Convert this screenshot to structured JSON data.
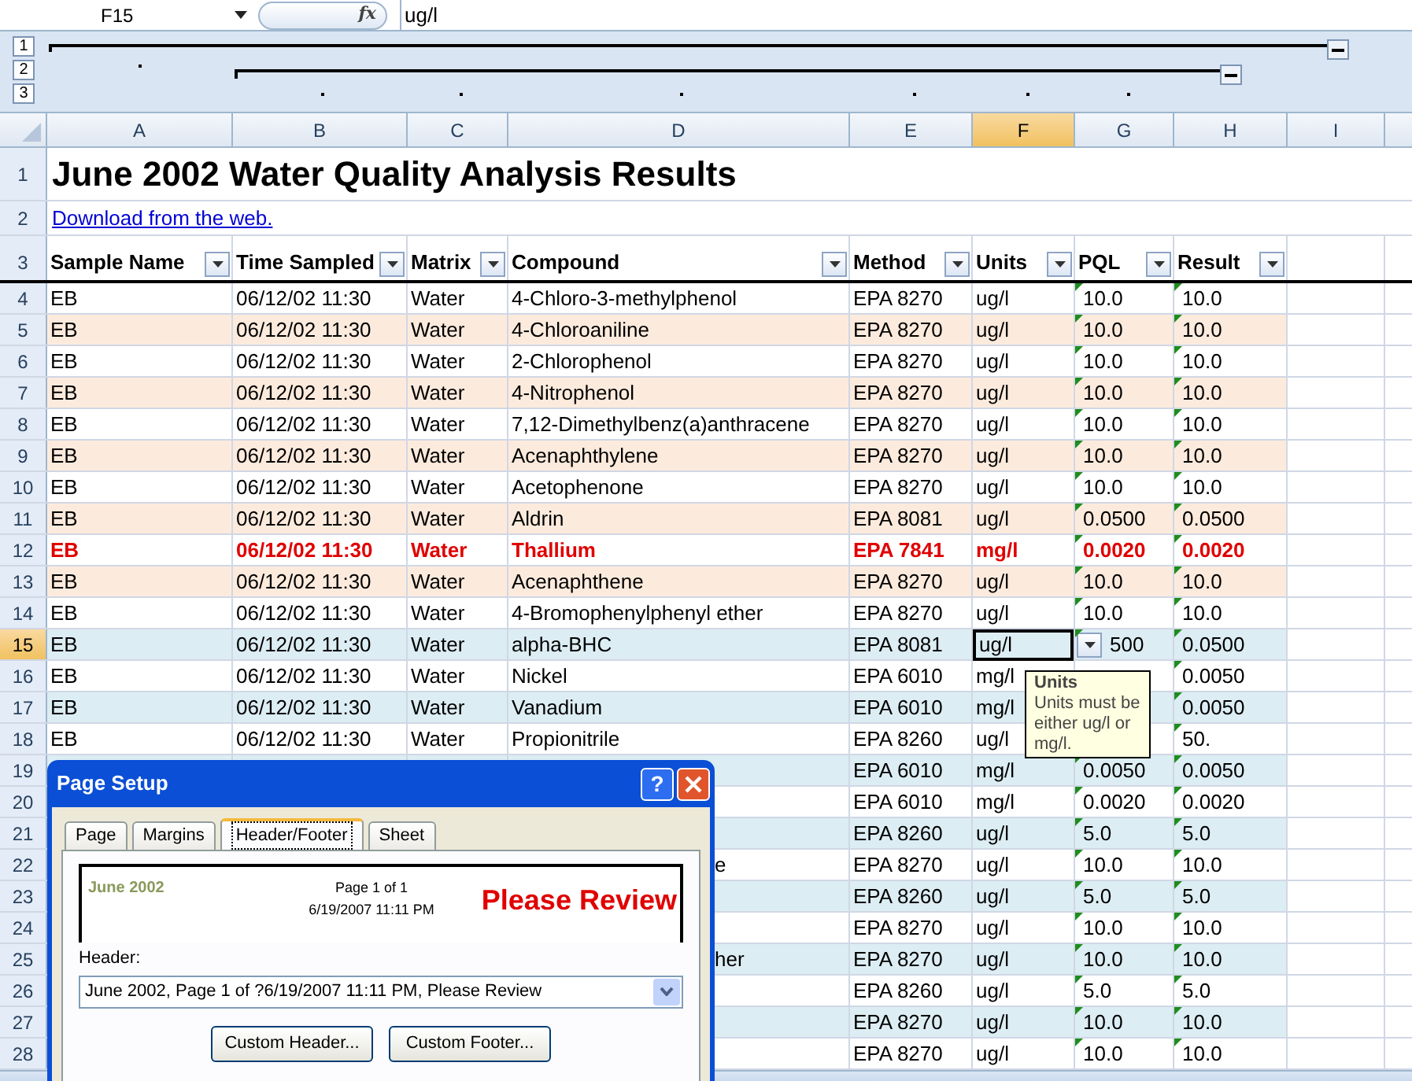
{
  "formula_bar": {
    "name_box": "F15",
    "function_label": "fx",
    "value": "ug/l"
  },
  "outline_levels": [
    "1",
    "2",
    "3"
  ],
  "columns": [
    {
      "label": "A",
      "selected": false
    },
    {
      "label": "B",
      "selected": false
    },
    {
      "label": "C",
      "selected": false
    },
    {
      "label": "D",
      "selected": false
    },
    {
      "label": "E",
      "selected": false
    },
    {
      "label": "F",
      "selected": true
    },
    {
      "label": "G",
      "selected": false
    },
    {
      "label": "H",
      "selected": false
    },
    {
      "label": "I",
      "selected": false
    }
  ],
  "title_row": {
    "n": "1",
    "title": "June 2002 Water Quality Analysis Results"
  },
  "link_row": {
    "n": "2",
    "link": "Download from the web."
  },
  "header_row": {
    "n": "3",
    "headers": [
      {
        "label": "Sample Name",
        "filter": true
      },
      {
        "label": "Time Sampled",
        "filter": true
      },
      {
        "label": "Matrix",
        "filter": true
      },
      {
        "label": "Compound",
        "filter": true
      },
      {
        "label": "Method",
        "filter": true
      },
      {
        "label": "Units",
        "filter": true
      },
      {
        "label": "PQL",
        "filter": true
      },
      {
        "label": "Result",
        "filter": true
      }
    ]
  },
  "rows": [
    {
      "n": "4",
      "color": "#ffffff",
      "flagged": false,
      "selected": false,
      "covered": false,
      "sample": "EB",
      "time": "06/12/02 11:30",
      "matrix": "Water",
      "compound": "4-Chloro-3-methylphenol",
      "method": "EPA 8270",
      "units": "ug/l",
      "pql": "10.0",
      "result": "10.0"
    },
    {
      "n": "5",
      "color": "#fcebdd",
      "flagged": false,
      "selected": false,
      "covered": false,
      "sample": "EB",
      "time": "06/12/02 11:30",
      "matrix": "Water",
      "compound": "4-Chloroaniline",
      "method": "EPA 8270",
      "units": "ug/l",
      "pql": "10.0",
      "result": "10.0"
    },
    {
      "n": "6",
      "color": "#ffffff",
      "flagged": false,
      "selected": false,
      "covered": false,
      "sample": "EB",
      "time": "06/12/02 11:30",
      "matrix": "Water",
      "compound": "2-Chlorophenol",
      "method": "EPA 8270",
      "units": "ug/l",
      "pql": "10.0",
      "result": "10.0"
    },
    {
      "n": "7",
      "color": "#fcebdd",
      "flagged": false,
      "selected": false,
      "covered": false,
      "sample": "EB",
      "time": "06/12/02 11:30",
      "matrix": "Water",
      "compound": "4-Nitrophenol",
      "method": "EPA 8270",
      "units": "ug/l",
      "pql": "10.0",
      "result": "10.0"
    },
    {
      "n": "8",
      "color": "#ffffff",
      "flagged": false,
      "selected": false,
      "covered": false,
      "sample": "EB",
      "time": "06/12/02 11:30",
      "matrix": "Water",
      "compound": "7,12-Dimethylbenz(a)anthracene",
      "method": "EPA 8270",
      "units": "ug/l",
      "pql": "10.0",
      "result": "10.0"
    },
    {
      "n": "9",
      "color": "#fcebdd",
      "flagged": false,
      "selected": false,
      "covered": false,
      "sample": "EB",
      "time": "06/12/02 11:30",
      "matrix": "Water",
      "compound": "Acenaphthylene",
      "method": "EPA 8270",
      "units": "ug/l",
      "pql": "10.0",
      "result": "10.0"
    },
    {
      "n": "10",
      "color": "#ffffff",
      "flagged": false,
      "selected": false,
      "covered": false,
      "sample": "EB",
      "time": "06/12/02 11:30",
      "matrix": "Water",
      "compound": "Acetophenone",
      "method": "EPA 8270",
      "units": "ug/l",
      "pql": "10.0",
      "result": "10.0"
    },
    {
      "n": "11",
      "color": "#fcebdd",
      "flagged": false,
      "selected": false,
      "covered": false,
      "sample": "EB",
      "time": "06/12/02 11:30",
      "matrix": "Water",
      "compound": "Aldrin",
      "method": "EPA 8081",
      "units": "ug/l",
      "pql": "0.0500",
      "result": "0.0500"
    },
    {
      "n": "12",
      "color": "#ffffff",
      "flagged": true,
      "selected": false,
      "covered": false,
      "sample": "EB",
      "time": "06/12/02 11:30",
      "matrix": "Water",
      "compound": "Thallium",
      "method": "EPA 7841",
      "units": "mg/l",
      "pql": "0.0020",
      "result": "0.0020"
    },
    {
      "n": "13",
      "color": "#fcebdd",
      "flagged": false,
      "selected": false,
      "covered": false,
      "sample": "EB",
      "time": "06/12/02 11:30",
      "matrix": "Water",
      "compound": "Acenaphthene",
      "method": "EPA 8270",
      "units": "ug/l",
      "pql": "10.0",
      "result": "10.0"
    },
    {
      "n": "14",
      "color": "#ffffff",
      "flagged": false,
      "selected": false,
      "covered": false,
      "sample": "EB",
      "time": "06/12/02 11:30",
      "matrix": "Water",
      "compound": "4-Bromophenylphenyl ether",
      "method": "EPA 8270",
      "units": "ug/l",
      "pql": "10.0",
      "result": "10.0"
    },
    {
      "n": "15",
      "color": "#dcedf3",
      "flagged": false,
      "selected": true,
      "covered": false,
      "validation_dropdown": true,
      "sample": "EB",
      "time": "06/12/02 11:30",
      "matrix": "Water",
      "compound": "alpha-BHC",
      "method": "EPA 8081",
      "units": "ug/l",
      "pql": "500",
      "result": "0.0500"
    },
    {
      "n": "16",
      "color": "#ffffff",
      "flagged": false,
      "selected": false,
      "covered": false,
      "sample": "EB",
      "time": "06/12/02 11:30",
      "matrix": "Water",
      "compound": "Nickel",
      "method": "EPA 6010",
      "units": "mg/l",
      "result": "0.0050"
    },
    {
      "n": "17",
      "color": "#dcedf3",
      "flagged": false,
      "selected": false,
      "covered": false,
      "sample": "EB",
      "time": "06/12/02 11:30",
      "matrix": "Water",
      "compound": "Vanadium",
      "method": "EPA 6010",
      "units": "mg/l",
      "result": "0.0050"
    },
    {
      "n": "18",
      "color": "#ffffff",
      "flagged": false,
      "selected": false,
      "covered": false,
      "sample": "EB",
      "time": "06/12/02 11:30",
      "matrix": "Water",
      "compound": "Propionitrile",
      "method": "EPA 8260",
      "units": "ug/l",
      "result": "50."
    },
    {
      "n": "19",
      "color": "#dcedf3",
      "flagged": false,
      "selected": false,
      "method": "EPA 6010",
      "units": "mg/l",
      "pql": "0.0050",
      "result": "0.0050"
    },
    {
      "n": "20",
      "color": "#ffffff",
      "flagged": false,
      "selected": false,
      "method": "EPA 6010",
      "units": "mg/l",
      "pql": "0.0020",
      "result": "0.0020"
    },
    {
      "n": "21",
      "color": "#dcedf3",
      "flagged": false,
      "selected": false,
      "method": "EPA 8260",
      "units": "ug/l",
      "pql": "5.0",
      "result": "5.0"
    },
    {
      "n": "22",
      "color": "#ffffff",
      "flagged": false,
      "selected": false,
      "covered": true,
      "compound": "e",
      "method": "EPA 8270",
      "units": "ug/l",
      "pql": "10.0",
      "result": "10.0"
    },
    {
      "n": "23",
      "color": "#dcedf3",
      "flagged": false,
      "selected": false,
      "method": "EPA 8260",
      "units": "ug/l",
      "pql": "5.0",
      "result": "5.0"
    },
    {
      "n": "24",
      "color": "#ffffff",
      "flagged": false,
      "selected": false,
      "method": "EPA 8270",
      "units": "ug/l",
      "pql": "10.0",
      "result": "10.0"
    },
    {
      "n": "25",
      "color": "#dcedf3",
      "flagged": false,
      "selected": false,
      "covered": true,
      "compound": "her",
      "method": "EPA 8270",
      "units": "ug/l",
      "pql": "10.0",
      "result": "10.0"
    },
    {
      "n": "26",
      "color": "#ffffff",
      "flagged": false,
      "selected": false,
      "method": "EPA 8260",
      "units": "ug/l",
      "pql": "5.0",
      "result": "5.0"
    },
    {
      "n": "27",
      "color": "#dcedf3",
      "flagged": false,
      "selected": false,
      "method": "EPA 8270",
      "units": "ug/l",
      "pql": "10.0",
      "result": "10.0"
    },
    {
      "n": "28",
      "color": "#ffffff",
      "flagged": false,
      "selected": false,
      "method": "EPA 8270",
      "units": "ug/l",
      "pql": "10.0",
      "result": "10.0"
    }
  ],
  "validation_tip": {
    "title": "Units",
    "message": "Units must be either ug/l or mg/l."
  },
  "dialog": {
    "title": "Page Setup",
    "help": "?",
    "tabs": [
      {
        "label": "Page",
        "selected": false
      },
      {
        "label": "Margins",
        "selected": false
      },
      {
        "label": "Header/Footer",
        "selected": true
      },
      {
        "label": "Sheet",
        "selected": false
      }
    ],
    "preview": {
      "left": "June 2002",
      "center_lines": [
        "Page 1 of 1",
        "6/19/2007 11:11 PM"
      ],
      "right": "Please Review"
    },
    "header_label": "Header:",
    "header_value": "June 2002, Page 1 of ?6/19/2007 11:11 PM, Please Review",
    "buttons": [
      "Custom Header...",
      "Custom Footer..."
    ]
  }
}
